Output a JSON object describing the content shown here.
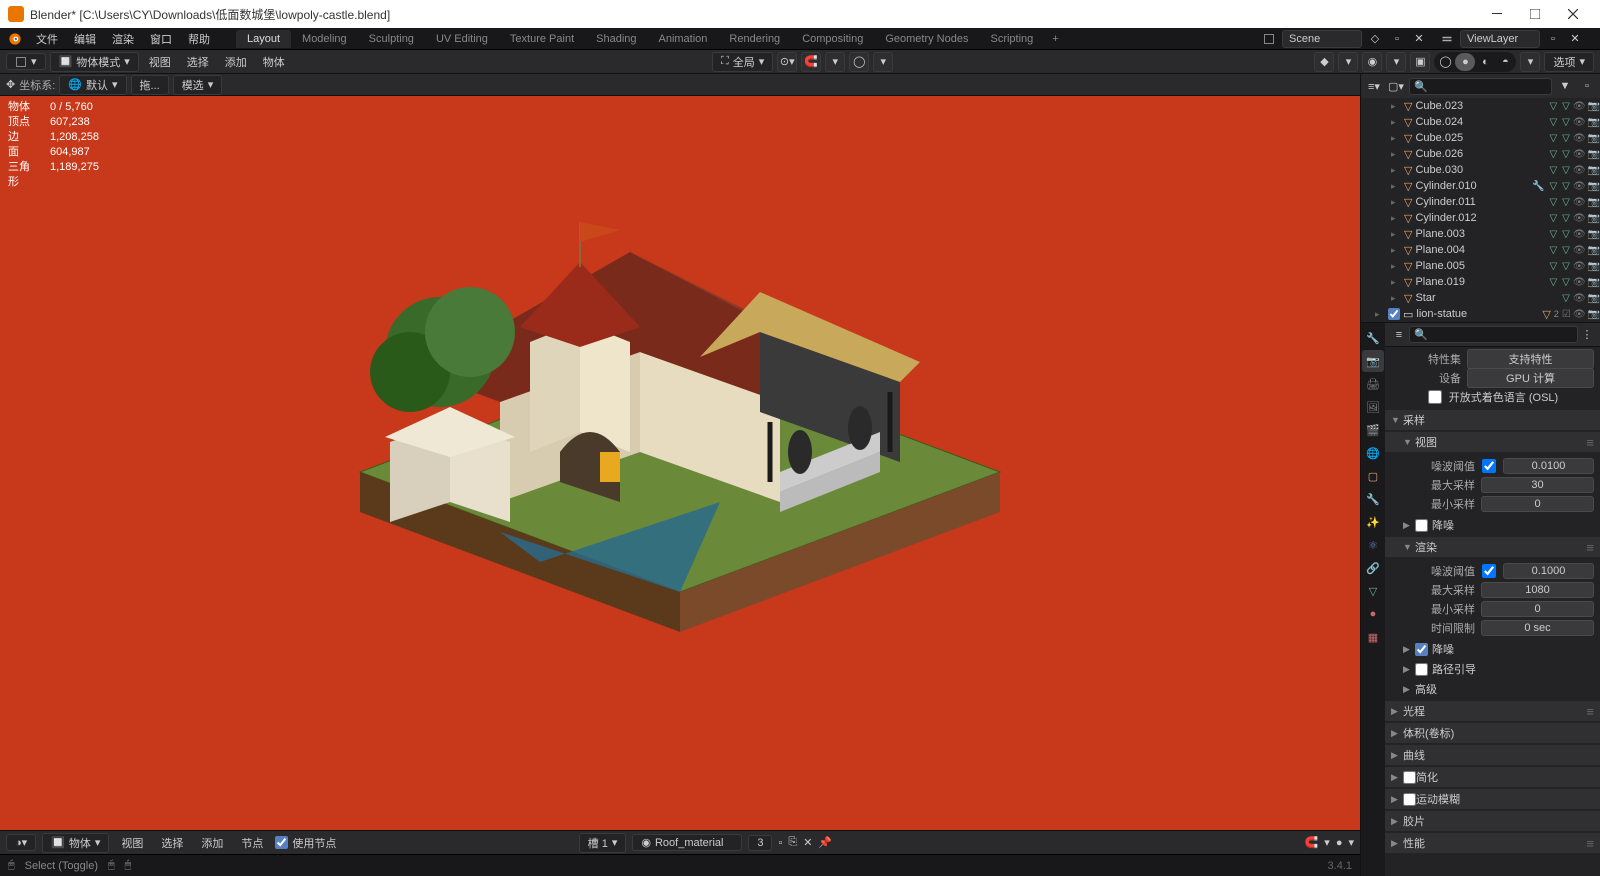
{
  "titlebar": {
    "app": "Blender",
    "path": "[C:\\Users\\CY\\Downloads\\低面数城堡\\lowpoly-castle.blend]"
  },
  "menu": {
    "file": "文件",
    "edit": "编辑",
    "render": "渲染",
    "window": "窗口",
    "help": "帮助"
  },
  "workspaces": {
    "items": [
      "Layout",
      "Modeling",
      "Sculpting",
      "UV Editing",
      "Texture Paint",
      "Shading",
      "Animation",
      "Rendering",
      "Compositing",
      "Geometry Nodes",
      "Scripting"
    ],
    "active": "Layout"
  },
  "scene": {
    "label": "Scene"
  },
  "viewlayer": {
    "label": "ViewLayer"
  },
  "vp_header": {
    "mode": "物体模式",
    "view": "视图",
    "select": "选择",
    "add": "添加",
    "object": "物体",
    "global": "全局",
    "options": "选项"
  },
  "vp_header2": {
    "orient_label": "坐标系:",
    "orient": "默认",
    "drag": "拖...",
    "transform": "模选"
  },
  "vp_stats": {
    "objects_label": "物体",
    "objects": "0 / 5,760",
    "verts_label": "顶点",
    "verts": "607,238",
    "edges_label": "边",
    "edges": "1,208,258",
    "faces_label": "面",
    "faces": "604,987",
    "tris_label": "三角形",
    "tris": "1,189,275"
  },
  "shader_hdr": {
    "mode": "物体",
    "view": "视图",
    "select": "选择",
    "add": "添加",
    "node": "节点",
    "use_nodes": "使用节点",
    "slot": "槽 1",
    "material": "Roof_material",
    "users": "3"
  },
  "statusbar": {
    "select": "Select (Toggle)",
    "version": "3.4.1"
  },
  "outliner": {
    "items": [
      {
        "name": "Cube.023",
        "type": "mesh"
      },
      {
        "name": "Cube.024",
        "type": "mesh"
      },
      {
        "name": "Cube.025",
        "type": "mesh"
      },
      {
        "name": "Cube.026",
        "type": "mesh"
      },
      {
        "name": "Cube.030",
        "type": "mesh"
      },
      {
        "name": "Cylinder.010",
        "type": "mesh_mod"
      },
      {
        "name": "Cylinder.011",
        "type": "mesh"
      },
      {
        "name": "Cylinder.012",
        "type": "mesh"
      },
      {
        "name": "Plane.003",
        "type": "mesh"
      },
      {
        "name": "Plane.004",
        "type": "mesh"
      },
      {
        "name": "Plane.005",
        "type": "mesh"
      },
      {
        "name": "Plane.019",
        "type": "mesh"
      },
      {
        "name": "Star",
        "type": "mesh_only"
      }
    ],
    "collection": {
      "name": "lion-statue",
      "count": "2"
    }
  },
  "props": {
    "feature_set_label": "特性集",
    "feature_set_value": "支持特性",
    "device_label": "设备",
    "device_value": "GPU 计算",
    "osl_label": "开放式着色语言 (OSL)",
    "sampling": "采样",
    "viewport": "视图",
    "noise_thresh_label": "噪波阈值",
    "noise_vp": "0.0100",
    "max_samples_label": "最大采样",
    "max_vp": "30",
    "min_samples_label": "最小采样",
    "min_vp": "0",
    "denoise": "降噪",
    "render": "渲染",
    "noise_rn": "0.1000",
    "max_rn": "1080",
    "min_rn": "0",
    "time_limit_label": "时间限制",
    "time_limit": "0 sec",
    "denoise_rn": "降噪",
    "path_guiding": "路径引导",
    "advanced": "高级",
    "light_paths": "光程",
    "volumes": "体积(卷标)",
    "curves": "曲线",
    "simplify": "简化",
    "motion_blur": "运动模糊",
    "film": "胶片",
    "performance": "性能"
  }
}
